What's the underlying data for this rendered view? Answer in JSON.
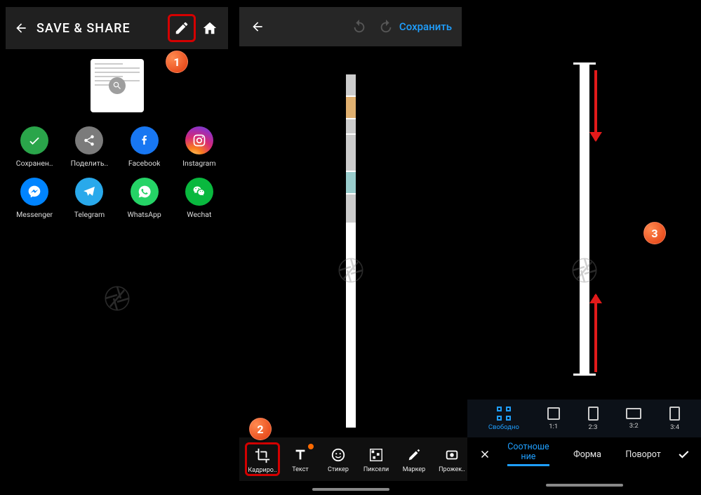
{
  "panel1": {
    "title": "SAVE & SHARE",
    "share": [
      {
        "label": "Сохранен..",
        "name": "save"
      },
      {
        "label": "Поделить..",
        "name": "share"
      },
      {
        "label": "Facebook",
        "name": "facebook"
      },
      {
        "label": "Instagram",
        "name": "instagram"
      },
      {
        "label": "Messenger",
        "name": "messenger"
      },
      {
        "label": "Telegram",
        "name": "telegram"
      },
      {
        "label": "WhatsApp",
        "name": "whatsapp"
      },
      {
        "label": "Wechat",
        "name": "wechat"
      }
    ]
  },
  "panel2": {
    "save_label": "Сохранить",
    "tools": [
      {
        "label": "Кадриро..",
        "name": "crop"
      },
      {
        "label": "Текст",
        "name": "text"
      },
      {
        "label": "Стикер",
        "name": "sticker"
      },
      {
        "label": "Пиксели",
        "name": "pixels"
      },
      {
        "label": "Маркер",
        "name": "marker"
      },
      {
        "label": "Прожек..",
        "name": "spotlight"
      }
    ]
  },
  "panel3": {
    "ratios": [
      {
        "label": "Свободно",
        "name": "free",
        "active": true
      },
      {
        "label": "1:1",
        "name": "1-1"
      },
      {
        "label": "2:3",
        "name": "2-3"
      },
      {
        "label": "3:2",
        "name": "3-2"
      },
      {
        "label": "3:4",
        "name": "3-4"
      }
    ],
    "tabs": [
      {
        "label": "Соотноше\nние",
        "name": "ratio",
        "active": true
      },
      {
        "label": "Форма",
        "name": "shape"
      },
      {
        "label": "Поворот",
        "name": "rotate"
      }
    ]
  },
  "badges": {
    "b1": "1",
    "b2": "2",
    "b3": "3"
  }
}
